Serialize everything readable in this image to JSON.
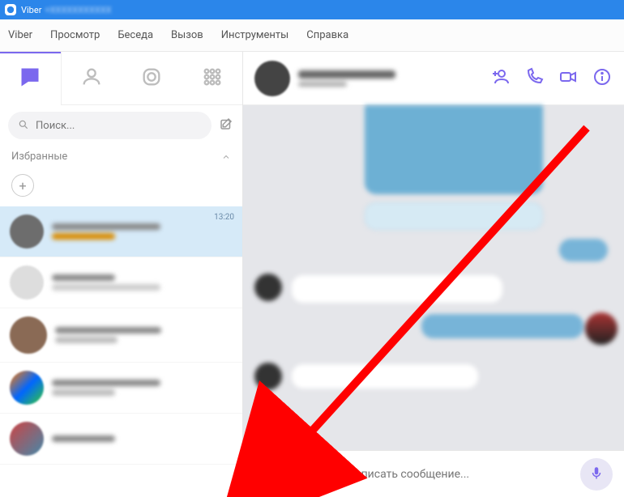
{
  "titlebar": {
    "app": "Viber",
    "suffix": "+XXXXXXXXXXX"
  },
  "menubar": [
    "Viber",
    "Просмотр",
    "Беседа",
    "Вызов",
    "Инструменты",
    "Справка"
  ],
  "sidebar": {
    "search": {
      "placeholder": "Поиск..."
    },
    "section": {
      "favorites": "Избранные"
    },
    "chat": {
      "time0": "13:20"
    }
  },
  "composer": {
    "placeholder": "Написать сообщение..."
  }
}
